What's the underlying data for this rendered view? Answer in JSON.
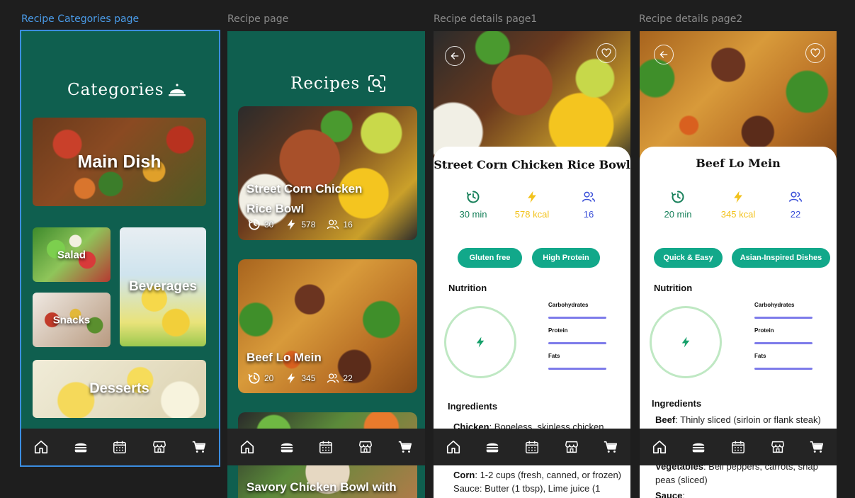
{
  "frames": {
    "categories_label": "Recipe Categories page",
    "recipe_label": "Recipe page",
    "details1_label": "Recipe details page1",
    "details2_label": "Recipe details page2"
  },
  "categories": {
    "title": "Categories",
    "items": [
      "Main Dish",
      "Salad",
      "Beverages",
      "Snacks",
      "Desserts"
    ]
  },
  "recipes": {
    "title": "Recipes",
    "cards": [
      {
        "title_line1": "Street Corn Chicken",
        "title_line2": "Rice Bowl",
        "time": "30",
        "kcal": "578",
        "servings": "16"
      },
      {
        "title_line1": "Beef Lo Mein",
        "title_line2": "",
        "time": "20",
        "kcal": "345",
        "servings": "22"
      },
      {
        "title_line1": "Savory Chicken Bowl with",
        "title_line2": "",
        "time": "",
        "kcal": "",
        "servings": ""
      }
    ]
  },
  "details1": {
    "title": "Street Corn Chicken Rice Bowl",
    "time": "30 min",
    "kcal": "578 kcal",
    "servings": "16",
    "tags": [
      "Gluten free",
      "High Protein"
    ],
    "nutrition_title": "Nutrition",
    "nutrients": [
      "Carbohydrates",
      "Protein",
      "Fats"
    ],
    "ingredients_title": "Ingredients",
    "ingredients": [
      {
        "name": "Chicken",
        "desc": ": Boneless, skinless chicken"
      },
      {
        "name": "Corn",
        "desc": ": 1-2 cups (fresh, canned, or frozen)"
      }
    ],
    "sauce_line": "Sauce: Butter (1 tbsp), Lime juice (1"
  },
  "details2": {
    "title": "Beef Lo Mein",
    "time": "20 min",
    "kcal": "345 kcal",
    "servings": "22",
    "tags": [
      "Quick & Easy",
      "Asian-Inspired Dishes"
    ],
    "nutrition_title": "Nutrition",
    "nutrients": [
      "Carbohydrates",
      "Protein",
      "Fats"
    ],
    "ingredients_title": "Ingredients",
    "ingredients": [
      {
        "name": "Beef",
        "desc": ": Thinly sliced (sirloin or flank steak)"
      },
      {
        "name": "Vegetables",
        "desc": ": Bell peppers, carrots, snap"
      }
    ],
    "veg_line2": "peas (sliced)",
    "sauce_label": "Sauce"
  },
  "colors": {
    "brand_green": "#0f5f4f",
    "pill_green": "#12a88a",
    "time_green": "#17805a",
    "kcal_yellow": "#f2c21b",
    "servings_blue": "#3a4fd8",
    "nutrition_bar": "#7d7bea",
    "selection_blue": "#3b8de0"
  },
  "icons": {
    "nav": [
      "home-icon",
      "burger-icon",
      "calendar-icon",
      "store-icon",
      "cart-icon"
    ],
    "header_categories": "cloche-icon",
    "header_recipes": "scan-search-icon",
    "back": "arrow-left-icon",
    "favorite": "heart-icon",
    "time": "clock-icon",
    "kcal": "bolt-icon",
    "servings": "users-icon"
  }
}
